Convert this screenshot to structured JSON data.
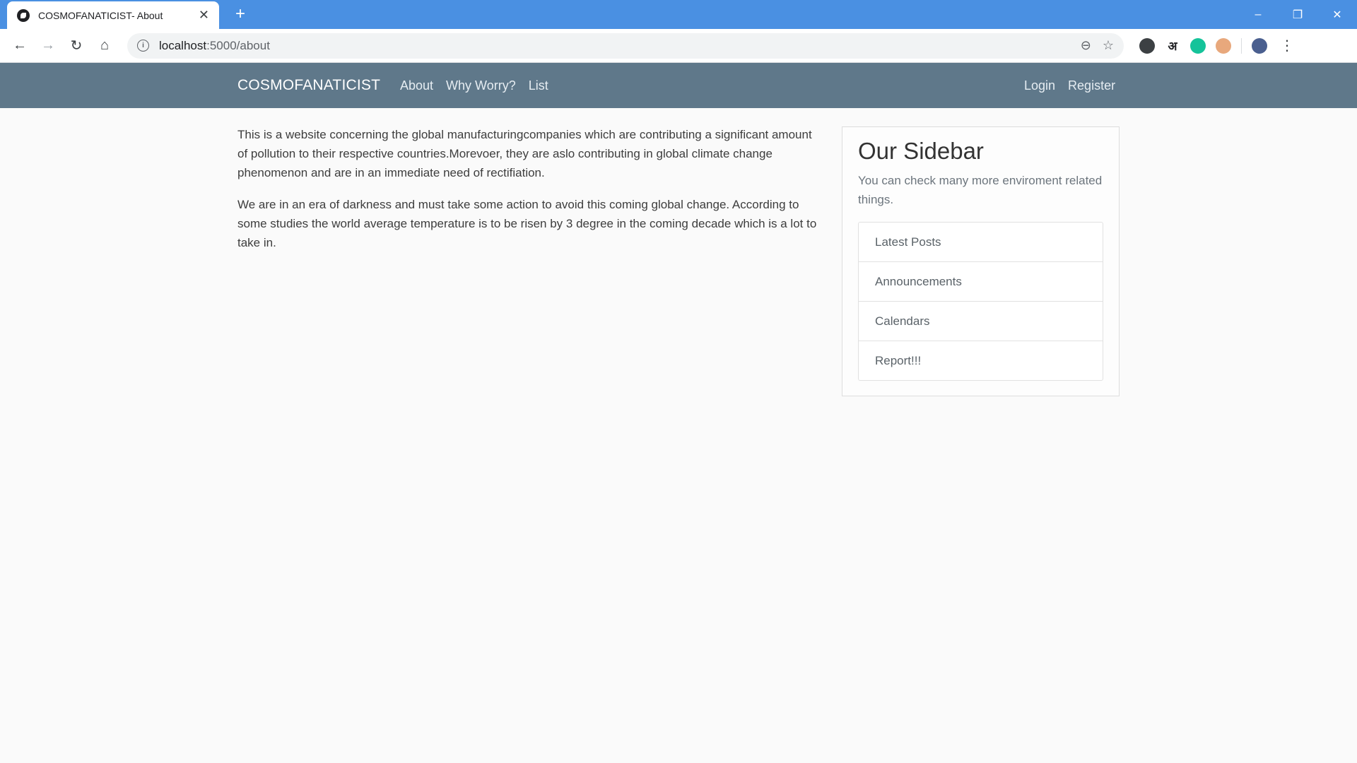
{
  "browser": {
    "tab_title": "COSMOFANATICIST- About",
    "url_host": "localhost",
    "url_path": ":5000/about",
    "new_tab_label": "+",
    "window_controls": {
      "minimize": "–",
      "restore": "❐",
      "close": "✕"
    },
    "extension_letter": "अ"
  },
  "navbar": {
    "brand": "COSMOFANATICIST",
    "links": [
      "About",
      "Why Worry?",
      "List"
    ],
    "right_links": [
      "Login",
      "Register"
    ]
  },
  "main": {
    "paragraphs": [
      "This is a website concerning the global manufacturingcompanies which are contributing a significant amount of pollution to their respective countries.Morevoer, they are aslo contributing in global climate change phenomenon and are in an immediate need of rectifiation.",
      "We are in an era of darkness and must take some action to avoid this coming global change. According to some studies the world average temperature is to be risen by 3 degree in the coming decade which is a lot to take in."
    ]
  },
  "sidebar": {
    "title": "Our Sidebar",
    "subtitle": "You can check many more enviroment related things.",
    "items": [
      "Latest Posts",
      "Announcements",
      "Calendars",
      "Report!!!"
    ]
  }
}
